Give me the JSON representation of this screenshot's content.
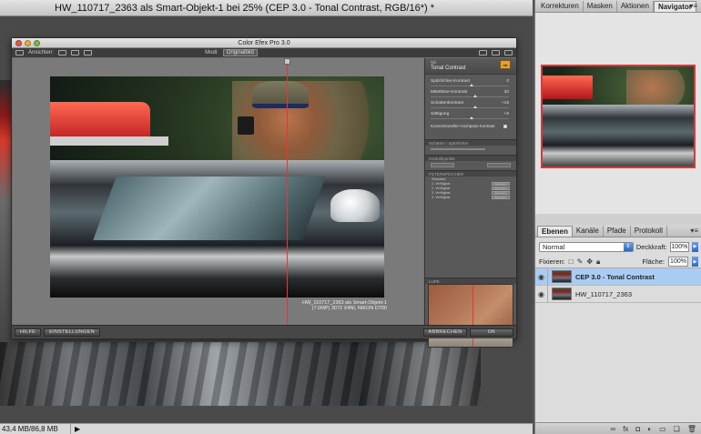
{
  "document": {
    "title": "HW_110717_2363 als Smart-Objekt-1 bei 25% (CEP 3.0 - Tonal Contrast, RGB/16*) *",
    "status_size": "43,4 MB/86,8 MB",
    "status_arrow": "▶"
  },
  "cep": {
    "title": "Color Efex Pro 3.0",
    "toolbar": {
      "views_label": "Ansichten:",
      "mode_label": "Modi:",
      "mode_value": "Originalbild"
    },
    "filter": {
      "small_label": "Nik",
      "name": "Tonal Contrast",
      "badge": "nik"
    },
    "sliders": [
      {
        "label": "Spitzlichter-Kontrast",
        "value": "0",
        "pos": 0.5
      },
      {
        "label": "Mitteltöne-Kontrast",
        "value": "30",
        "pos": 0.55
      },
      {
        "label": "Schattenkontrast",
        "value": "+15",
        "pos": 0.55
      },
      {
        "label": "Sättigung",
        "value": "+5",
        "pos": 0.5
      }
    ],
    "checkbox_label": "Konventioneller Hochpass-Kontrast",
    "section_shadows": "Schatten / Spitzlichter",
    "section_control_points": "Kontrollpunkte",
    "section_presets": "FILTERSPEICHER",
    "presets": [
      {
        "label": "Standard",
        "button": ""
      },
      {
        "label": "1. Verfügbar",
        "button": "Speichern"
      },
      {
        "label": "2. Verfügbar",
        "button": "Speichern"
      },
      {
        "label": "3. Verfügbar",
        "button": "Speichern"
      },
      {
        "label": "4. Verfügbar",
        "button": "Speichern"
      }
    ],
    "section_loupe": "LUPE",
    "caption_line1": "HW_110717_2363 als Smart-Objekt-1",
    "caption_line2": "(7.0MP) 3072 X4NI, NIKON D700",
    "buttons": {
      "help": "HILFE",
      "settings": "EINSTELLUNGEN",
      "cancel": "ABBRECHEN",
      "ok": "OK"
    }
  },
  "nav_panel": {
    "tabs": [
      "Korrekturen",
      "Masken",
      "Aktionen",
      "Navigator"
    ],
    "active_tab": "Navigator"
  },
  "layers_panel": {
    "tabs": [
      "Ebenen",
      "Kanäle",
      "Pfade",
      "Protokoll"
    ],
    "active_tab": "Ebenen",
    "blend_mode": "Normal",
    "opacity_label": "Deckkraft:",
    "opacity_value": "100%",
    "lock_label": "Fixieren:",
    "fill_label": "Fläche:",
    "fill_value": "100%",
    "layers": [
      {
        "name": "CEP 3.0 - Tonal Contrast",
        "selected": true
      },
      {
        "name": "HW_110717_2363",
        "selected": false
      }
    ]
  }
}
